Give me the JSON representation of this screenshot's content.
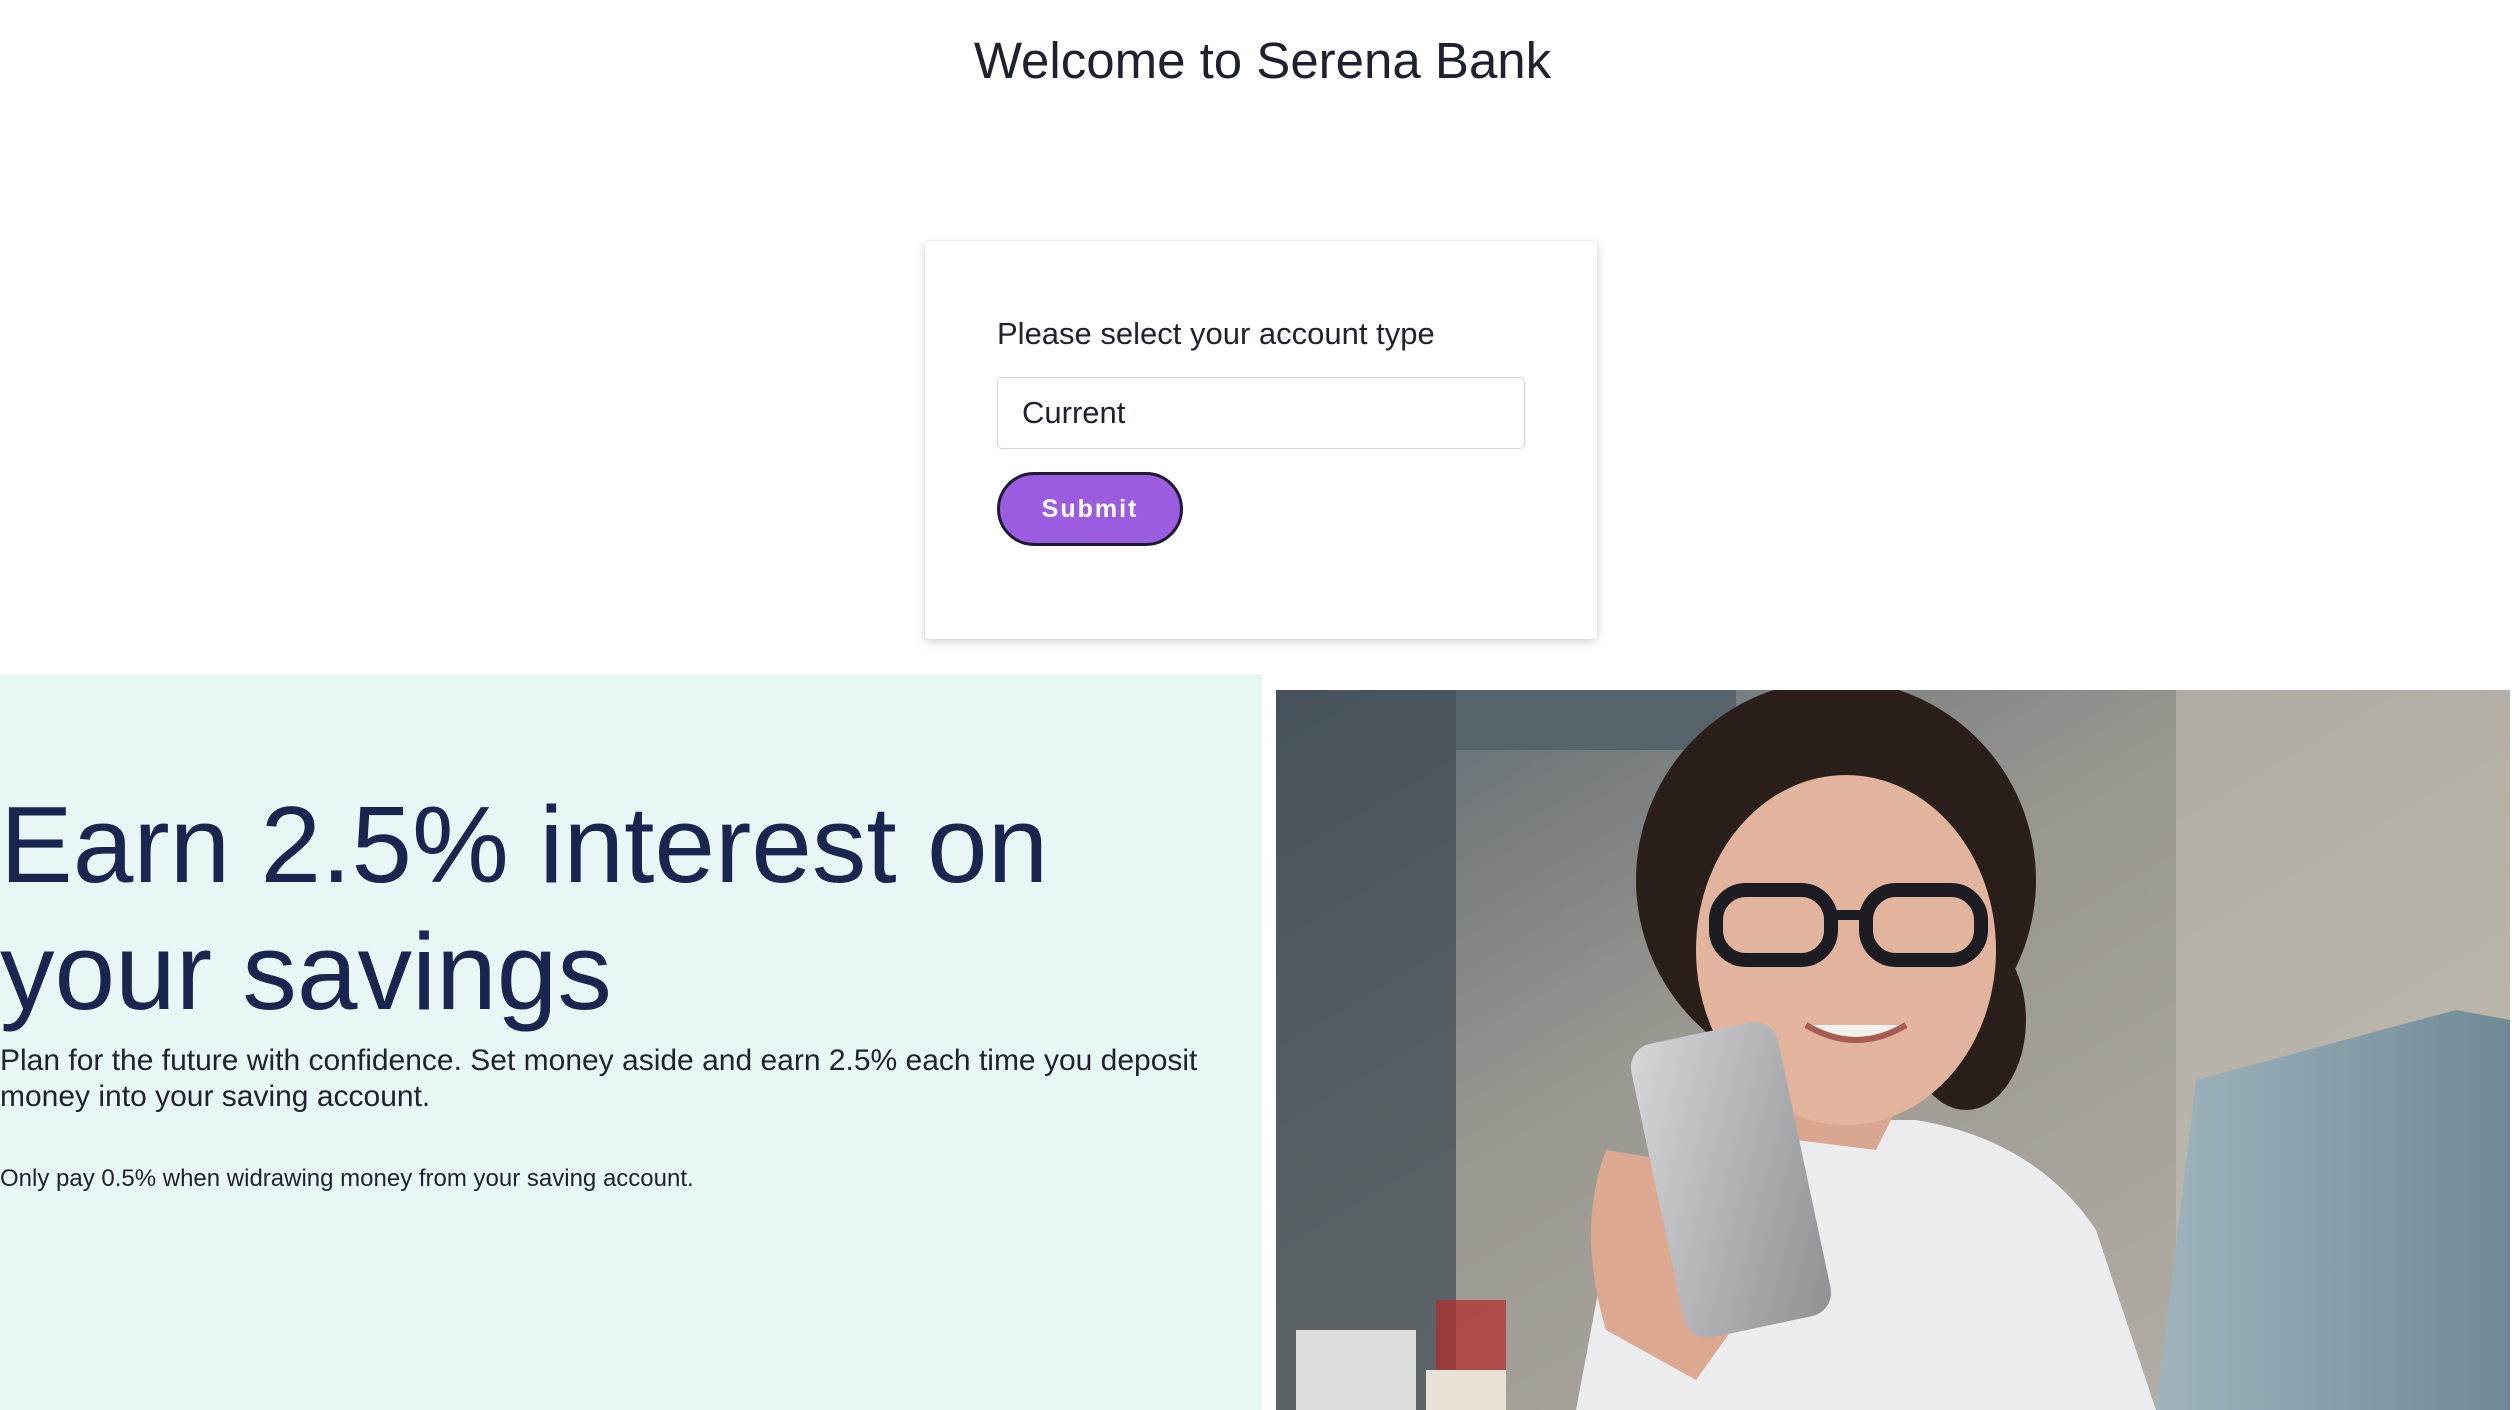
{
  "header": {
    "title": "Welcome to Serena Bank"
  },
  "account_form": {
    "label": "Please select your account type",
    "select": {
      "selected_value": "Current"
    },
    "submit_label": "Submit"
  },
  "promo": {
    "heading": "Earn 2.5% interest on your savings",
    "body": "Plan for the future with confidence. Set money aside and earn 2.5% each time you deposit money into your saving account.",
    "note": "Only pay 0.5% when widrawing money from your saving account."
  },
  "colors": {
    "accent": "#9b5ce0",
    "promo_background": "#e9f6f6",
    "heading_color": "#1a2550"
  }
}
